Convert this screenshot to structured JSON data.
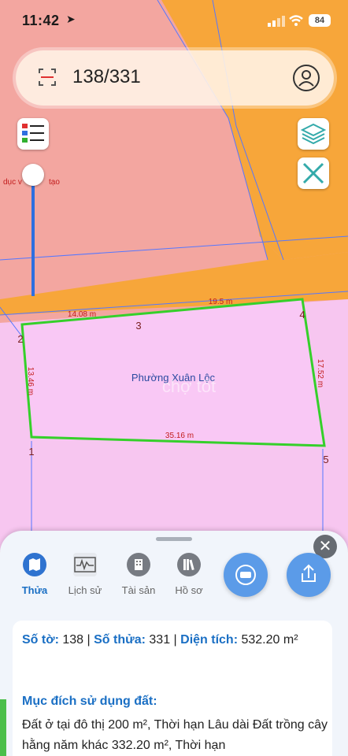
{
  "status_bar": {
    "time": "11:42",
    "battery": "84"
  },
  "search": {
    "value": "138/331"
  },
  "map": {
    "partial_label": "dục v",
    "partial_label2": "tạo",
    "ward_label": "Phường Xuân Lộc",
    "watermark": "chợ tốt",
    "points": [
      "1",
      "2",
      "3",
      "4",
      "5"
    ],
    "edges": [
      "14.08 m",
      "19.5 m",
      "13.46 m",
      "17.52 m",
      "35.16 m"
    ]
  },
  "panel": {
    "tabs": [
      {
        "label": "Thửa",
        "icon": "map-icon"
      },
      {
        "label": "Lịch sử",
        "icon": "history-chart-icon"
      },
      {
        "label": "Tài sản",
        "icon": "building-icon"
      },
      {
        "label": "Hồ sơ",
        "icon": "books-icon"
      }
    ],
    "fab_left_icon": "car-icon",
    "fab_right_icon": "share-icon",
    "info": {
      "so_to_label": "Số tờ:",
      "so_to_value": "138",
      "so_thua_label": "Số thửa:",
      "so_thua_value": "331",
      "dien_tich_label": "Diện tích:",
      "dien_tich_value": "532.20 m²",
      "muc_dich_label": "Mục đích sử dụng đất:",
      "muc_dich_text": "Đất ở tại đô thị 200 m², Thời hạn Lâu dài Đất trồng cây hằng năm khác 332.20 m², Thời hạn"
    }
  },
  "colors": {
    "pink": "#f7c6f0",
    "salmon": "#f3a6a0",
    "orange": "#f7a63a",
    "accent": "#1a6fc4"
  }
}
